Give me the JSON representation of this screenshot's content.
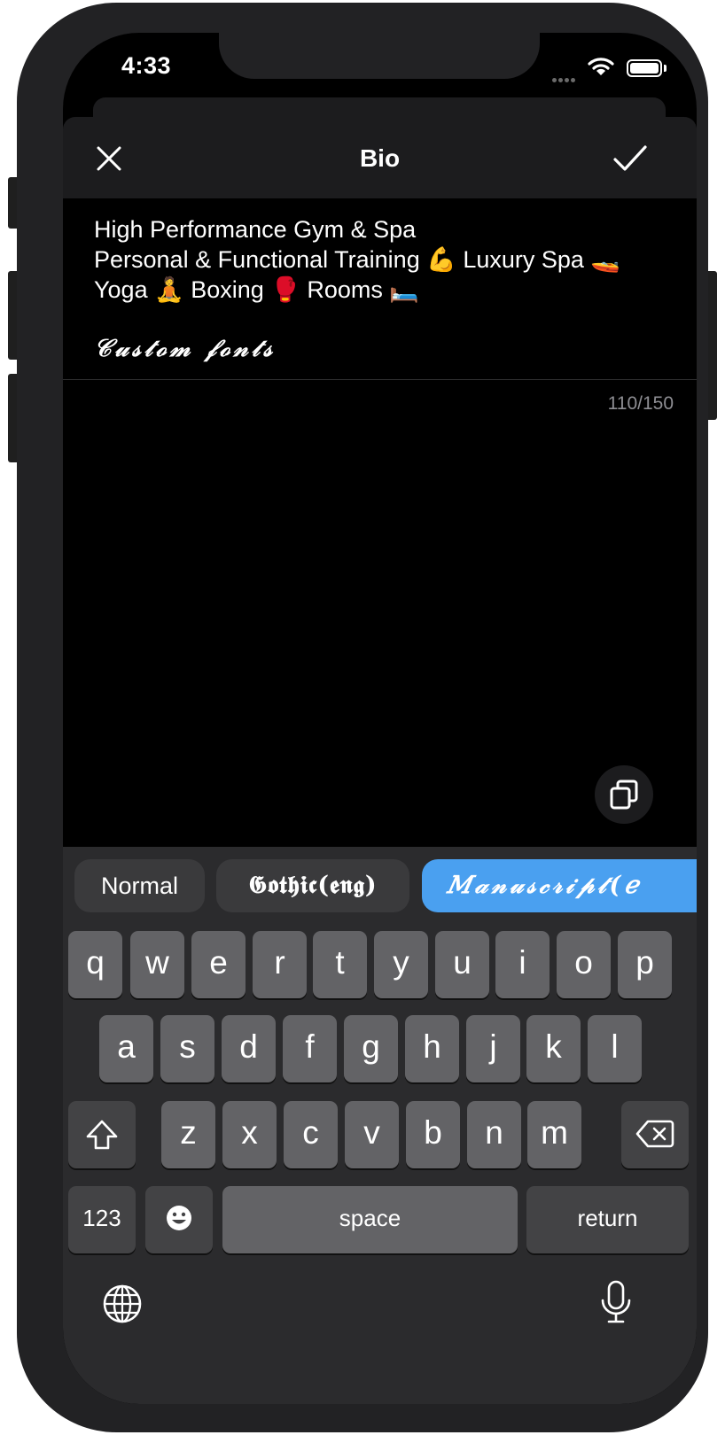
{
  "status_bar": {
    "time": "4:33"
  },
  "nav": {
    "title": "Bio"
  },
  "bio": {
    "lines": [
      "High Performance Gym & Spa",
      "Personal & Functional Training 💪 Luxury Spa 🚤",
      "Yoga 🧘 Boxing 🥊 Rooms 🛏️"
    ],
    "fancy_line": "𝒞𝓊𝓈𝓉ℴ𝓂 𝒻ℴ𝓃𝓉𝓈",
    "counter": "110/150"
  },
  "font_styles": [
    "Normal",
    "𝕲𝖔𝖙𝖍𝖎𝖈(𝖊𝖓𝖌)",
    "𝑀𝒶𝓃𝓊𝓈𝒸𝓇𝒾𝓅𝓉(𝑒"
  ],
  "keyboard": {
    "row1": [
      "q",
      "w",
      "e",
      "r",
      "t",
      "y",
      "u",
      "i",
      "o",
      "p"
    ],
    "row2": [
      "a",
      "s",
      "d",
      "f",
      "g",
      "h",
      "j",
      "k",
      "l"
    ],
    "row3": [
      "z",
      "x",
      "c",
      "v",
      "b",
      "n",
      "m"
    ],
    "numbers_key": "123",
    "space_key": "space",
    "return_key": "return"
  },
  "icons": {
    "close": "close-icon",
    "done": "checkmark-icon",
    "copy": "copy-icon",
    "shift": "shift-icon",
    "delete": "backspace-icon",
    "emoji": "emoji-icon",
    "globe": "globe-icon",
    "mic": "microphone-icon",
    "wifi": "wifi-icon",
    "battery": "battery-icon"
  },
  "colors": {
    "accent": "#4aa0f0",
    "background": "#000000",
    "nav": "#1c1c1e",
    "keyboard": "#2b2b2d",
    "key": "#636366"
  }
}
